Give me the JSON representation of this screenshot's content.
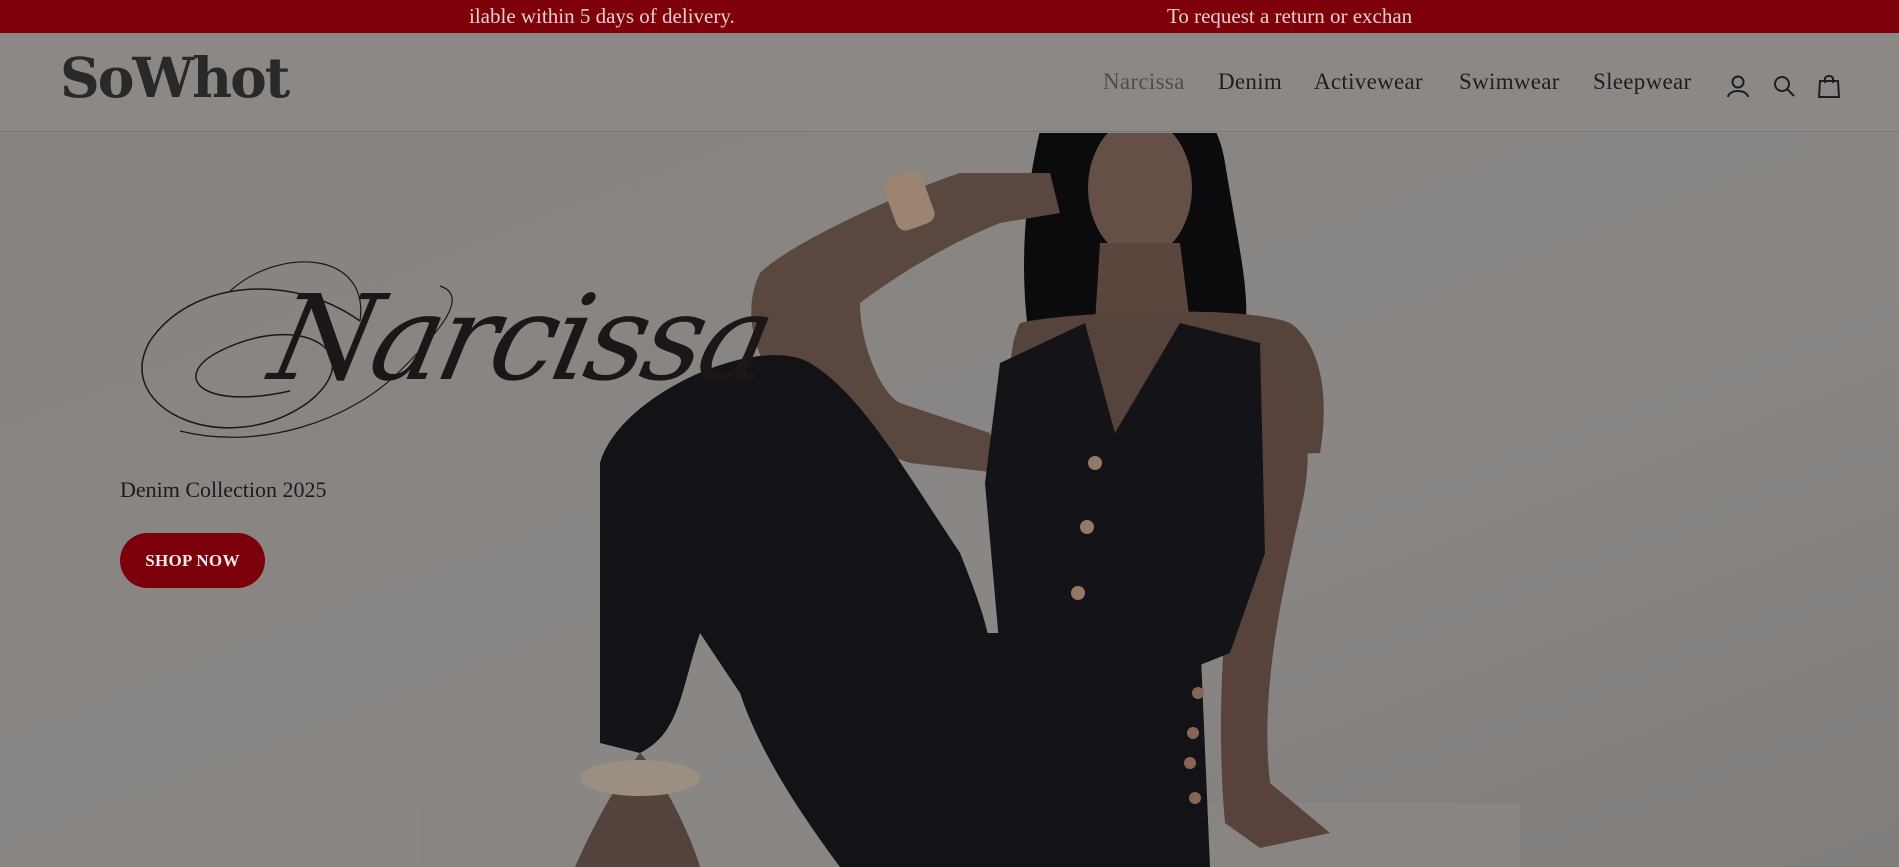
{
  "announcement": {
    "messages": [
      "ilable within 5 days of delivery.",
      "To request a return or exchan"
    ],
    "background_color": "#7d000a"
  },
  "header": {
    "logo_text": "SoWhot",
    "nav_items": [
      "Narcissa",
      "Denim",
      "Activewear",
      "Swimwear",
      "Sleepwear"
    ],
    "icons": [
      "account-icon",
      "search-icon",
      "cart-icon"
    ]
  },
  "hero": {
    "logo_text": "Narcissa",
    "subtitle": "Denim Collection 2025",
    "cta_label": "SHOP NOW",
    "cta_color": "#7c000b"
  }
}
